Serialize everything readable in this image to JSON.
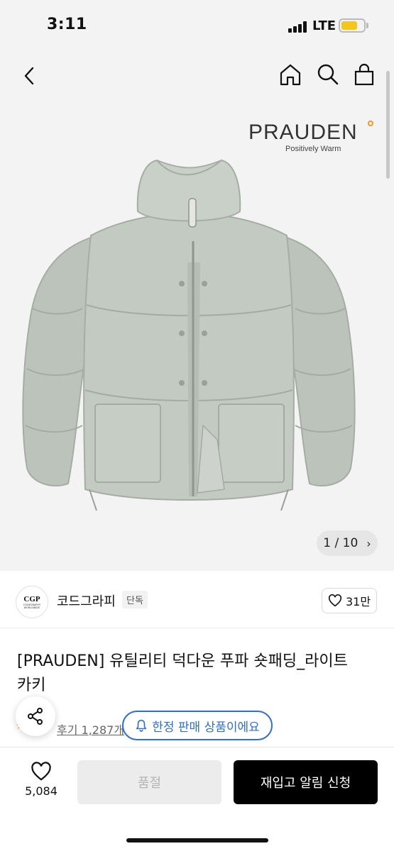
{
  "status_bar": {
    "time": "3:11",
    "network": "LTE",
    "battery_color": "#f4c51a"
  },
  "nav": {
    "icons": [
      "chevron-left-icon",
      "home-icon",
      "search-icon",
      "shopping-bag-icon"
    ]
  },
  "hero": {
    "brand_logo": "PRAUDEN",
    "brand_tagline": "Positively Warm",
    "image_counter": "1 / 10",
    "next_icon": "chevron-right-icon",
    "background": "#f3f3f3"
  },
  "store": {
    "logo_text": "CGP",
    "logo_subtext": "CODEGRAPHY WORLDWIDE",
    "name": "코드그라피",
    "badge": "단독",
    "likes": "31만"
  },
  "product": {
    "title_line1": "[PRAUDEN] 유틸리티 덕다운 푸파 숏패딩_라이트",
    "title_line2": "카키",
    "review_label": "후기 1,287개",
    "limited_label": "한정 판매 상품이에요",
    "accent_color": "#2a6fe0"
  },
  "bottom_bar": {
    "wish_count": "5,084",
    "soldout_label": "품절",
    "restock_label": "재입고 알림 신청"
  }
}
